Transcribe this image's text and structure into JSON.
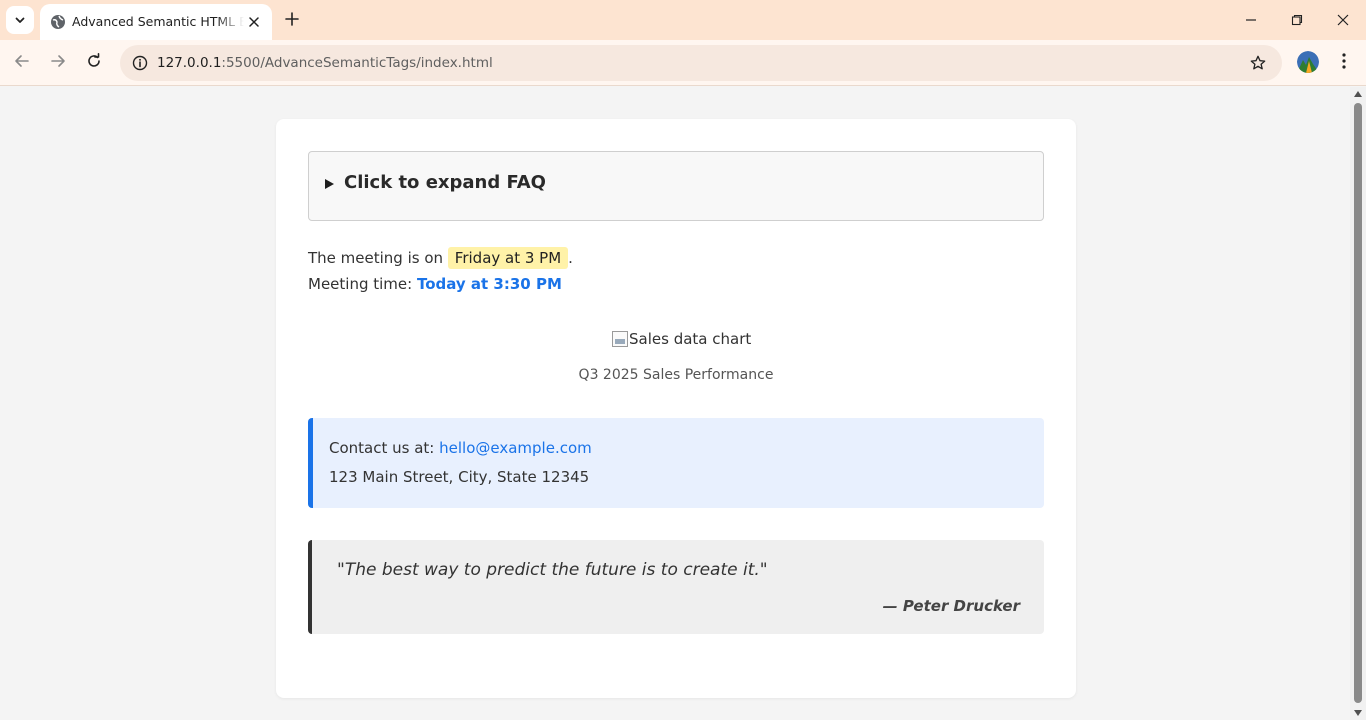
{
  "browser": {
    "tab_title": "Advanced Semantic HTML Examples",
    "url_host": "127.0.0.1",
    "url_rest": ":5500/AdvanceSemanticTags/index.html"
  },
  "page": {
    "faq_summary": "Click to expand FAQ",
    "meeting_prefix": "The meeting is on",
    "meeting_day": "Friday at 3 PM",
    "meeting_suffix": ".",
    "meeting_time_label": "Meeting time:",
    "meeting_time_value": "Today at 3:30 PM",
    "figure_alt": "Sales data chart",
    "figure_caption": "Q3 2025 Sales Performance",
    "contact_prefix": "Contact us at:",
    "contact_email": "hello@example.com",
    "contact_address": "123 Main Street, City, State 12345",
    "quote_text": "\"The best way to predict the future is to create it.\"",
    "quote_cite": "— Peter Drucker"
  },
  "colors": {
    "tabbar": "#fde4d1",
    "accent_link": "#1a73e8",
    "mark_bg": "#fff2a8"
  }
}
